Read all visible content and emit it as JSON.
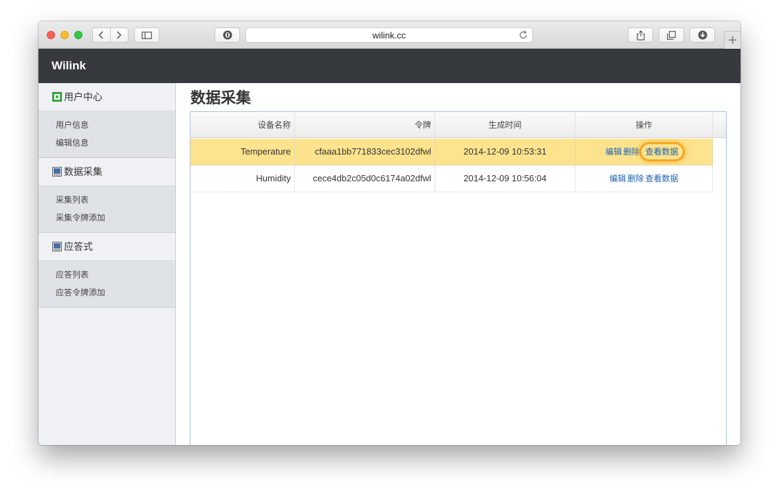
{
  "browser": {
    "url": "wilink.cc"
  },
  "site": {
    "brand": "Wilink"
  },
  "sidebar": {
    "sections": [
      {
        "title": "用户中心",
        "items": [
          "用户信息",
          "编辑信息"
        ]
      },
      {
        "title": "数据采集",
        "items": [
          "采集列表",
          "采集令牌添加"
        ]
      },
      {
        "title": "应答式",
        "items": [
          "应答列表",
          "应答令牌添加"
        ]
      }
    ]
  },
  "main": {
    "title": "数据采集",
    "columns": [
      "设备名称",
      "令牌",
      "生成时间",
      "操作"
    ],
    "rows": [
      {
        "name": "Temperature",
        "token": "cfaaa1bb771833cec3102dfwl",
        "time": "2014-12-09 10:53:31",
        "actions": [
          "编辑",
          "删除",
          "查看数据"
        ],
        "selected": true
      },
      {
        "name": "Humidity",
        "token": "cece4db2c05d0c6174a02dfwl",
        "time": "2014-12-09 10:56:04",
        "actions": [
          "编辑",
          "删除",
          "查看数据"
        ],
        "selected": false
      }
    ]
  },
  "colors": {
    "header_bg": "#36393e",
    "selected_row": "#fde38e",
    "link": "#1f63b5",
    "highlight_ring": "#f5a623"
  }
}
